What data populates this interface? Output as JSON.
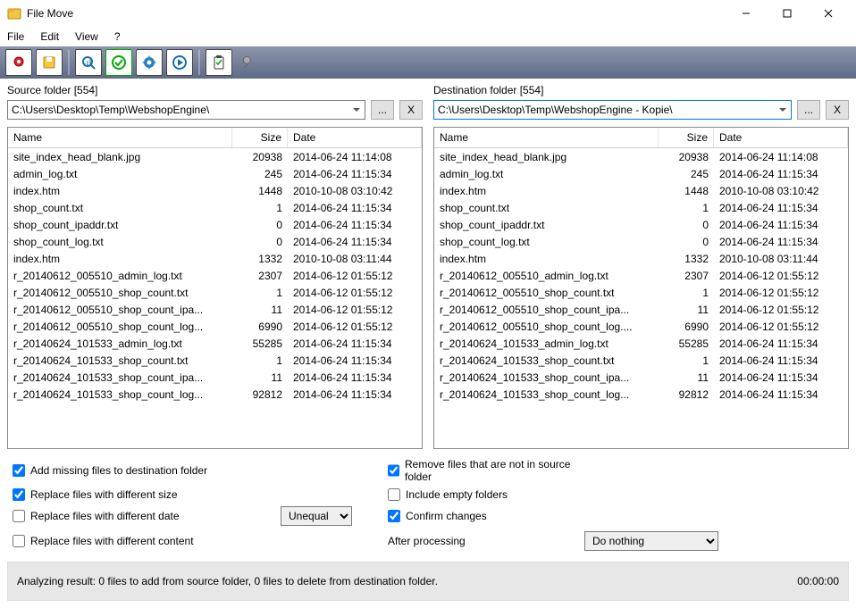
{
  "window": {
    "title": "File Move"
  },
  "menu": {
    "file": "File",
    "edit": "Edit",
    "view": "View",
    "help": "?"
  },
  "source": {
    "label": "Source folder [554]",
    "path": "C:\\Users\\Desktop\\Temp\\WebshopEngine\\"
  },
  "destination": {
    "label": "Destination folder [554]",
    "path": "C:\\Users\\Desktop\\Temp\\WebshopEngine - Kopie\\"
  },
  "browse_btn": "...",
  "x_btn": "X",
  "columns": {
    "name": "Name",
    "size": "Size",
    "date": "Date"
  },
  "files": [
    {
      "name": "site_index_head_blank.jpg",
      "size": "20938",
      "date": "2014-06-24 11:14:08"
    },
    {
      "name": "admin_log.txt",
      "size": "245",
      "date": "2014-06-24 11:15:34"
    },
    {
      "name": "index.htm",
      "size": "1448",
      "date": "2010-10-08 03:10:42"
    },
    {
      "name": "shop_count.txt",
      "size": "1",
      "date": "2014-06-24 11:15:34"
    },
    {
      "name": "shop_count_ipaddr.txt",
      "size": "0",
      "date": "2014-06-24 11:15:34"
    },
    {
      "name": "shop_count_log.txt",
      "size": "0",
      "date": "2014-06-24 11:15:34"
    },
    {
      "name": "index.htm",
      "size": "1332",
      "date": "2010-10-08 03:11:44"
    },
    {
      "name": "r_20140612_005510_admin_log.txt",
      "size": "2307",
      "date": "2014-06-12 01:55:12"
    },
    {
      "name": "r_20140612_005510_shop_count.txt",
      "size": "1",
      "date": "2014-06-12 01:55:12"
    },
    {
      "name": "r_20140612_005510_shop_count_ipa...",
      "size": "11",
      "date": "2014-06-12 01:55:12"
    },
    {
      "name": "r_20140612_005510_shop_count_log...",
      "size": "6990",
      "date": "2014-06-12 01:55:12"
    },
    {
      "name": "r_20140624_101533_admin_log.txt",
      "size": "55285",
      "date": "2014-06-24 11:15:34"
    },
    {
      "name": "r_20140624_101533_shop_count.txt",
      "size": "1",
      "date": "2014-06-24 11:15:34"
    },
    {
      "name": "r_20140624_101533_shop_count_ipa...",
      "size": "11",
      "date": "2014-06-24 11:15:34"
    },
    {
      "name": "r_20140624_101533_shop_count_log...",
      "size": "92812",
      "date": "2014-06-24 11:15:34"
    }
  ],
  "dest_files": [
    {
      "name": "site_index_head_blank.jpg",
      "size": "20938",
      "date": "2014-06-24 11:14:08"
    },
    {
      "name": "admin_log.txt",
      "size": "245",
      "date": "2014-06-24 11:15:34"
    },
    {
      "name": "index.htm",
      "size": "1448",
      "date": "2010-10-08 03:10:42"
    },
    {
      "name": "shop_count.txt",
      "size": "1",
      "date": "2014-06-24 11:15:34"
    },
    {
      "name": "shop_count_ipaddr.txt",
      "size": "0",
      "date": "2014-06-24 11:15:34"
    },
    {
      "name": "shop_count_log.txt",
      "size": "0",
      "date": "2014-06-24 11:15:34"
    },
    {
      "name": "index.htm",
      "size": "1332",
      "date": "2010-10-08 03:11:44"
    },
    {
      "name": "r_20140612_005510_admin_log.txt",
      "size": "2307",
      "date": "2014-06-12 01:55:12"
    },
    {
      "name": "r_20140612_005510_shop_count.txt",
      "size": "1",
      "date": "2014-06-12 01:55:12"
    },
    {
      "name": "r_20140612_005510_shop_count_ipa...",
      "size": "11",
      "date": "2014-06-12 01:55:12"
    },
    {
      "name": "r_20140612_005510_shop_count_log....",
      "size": "6990",
      "date": "2014-06-12 01:55:12"
    },
    {
      "name": "r_20140624_101533_admin_log.txt",
      "size": "55285",
      "date": "2014-06-24 11:15:34"
    },
    {
      "name": "r_20140624_101533_shop_count.txt",
      "size": "1",
      "date": "2014-06-24 11:15:34"
    },
    {
      "name": "r_20140624_101533_shop_count_ipa...",
      "size": "11",
      "date": "2014-06-24 11:15:34"
    },
    {
      "name": "r_20140624_101533_shop_count_log...",
      "size": "92812",
      "date": "2014-06-24 11:15:34"
    }
  ],
  "options": {
    "add_missing": "Add missing files to destination folder",
    "replace_size": "Replace files with different size",
    "replace_date": "Replace files with different date",
    "replace_content": "Replace files with different content",
    "remove_not_in_source": "Remove files that are not in source folder",
    "include_empty": "Include empty folders",
    "confirm": "Confirm changes",
    "after_processing": "After processing",
    "date_compare_value": "Unequal",
    "after_value": "Do nothing"
  },
  "status": {
    "message": "Analyzing result: 0 files to add from source folder, 0 files to delete from destination folder.",
    "time": "00:00:00"
  }
}
